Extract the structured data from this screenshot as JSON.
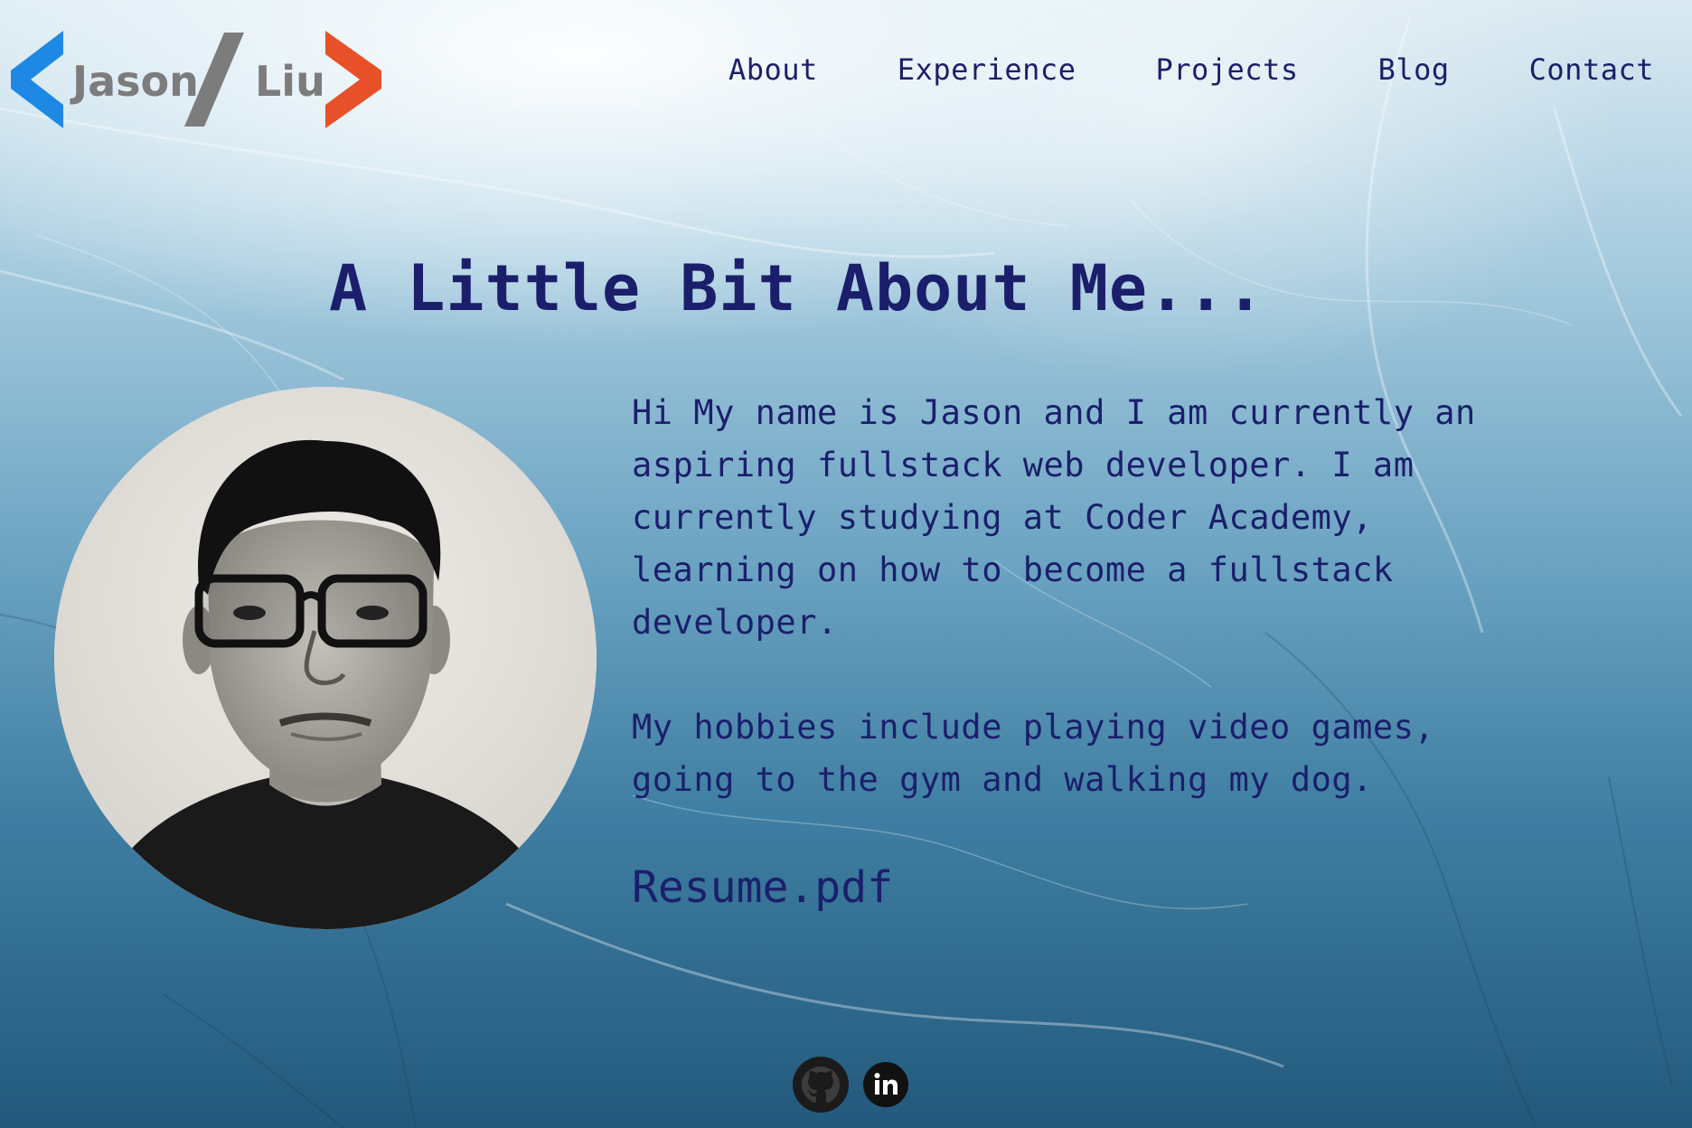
{
  "logo": {
    "first_name": "Jason",
    "last_name": "Liu",
    "colors": {
      "left_chevron": "#1e88e5",
      "slash": "#7c7c7c",
      "right_chevron": "#e8502a"
    }
  },
  "nav": {
    "items": [
      {
        "label": "About"
      },
      {
        "label": "Experience"
      },
      {
        "label": "Projects"
      },
      {
        "label": "Blog"
      },
      {
        "label": "Contact"
      }
    ]
  },
  "main": {
    "title": "A Little Bit About Me...",
    "bio_paragraph_1": "Hi My name is Jason and I am currently an aspiring fullstack web developer. I am currently studying at Coder Academy, learning on how to become a fullstack developer.",
    "bio_paragraph_2": "My hobbies include playing video games, going to the gym and walking my dog.",
    "resume_label": "Resume.pdf"
  },
  "socials": {
    "icons": [
      "github-icon",
      "linkedin-icon"
    ]
  },
  "theme": {
    "text_color": "#1b1f6b",
    "background": "ice-blue"
  }
}
